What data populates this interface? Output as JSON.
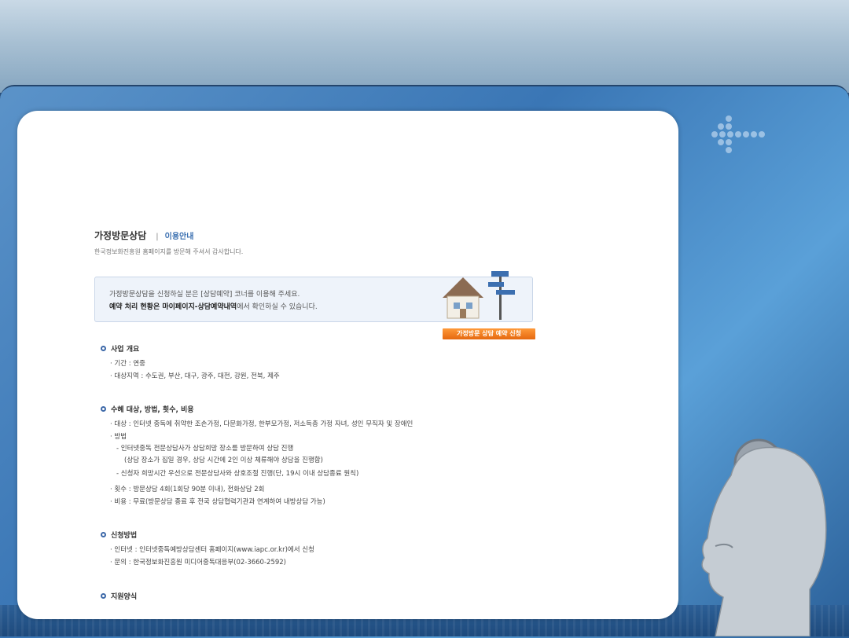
{
  "header": {
    "title": "가정방문상담",
    "separator": "|",
    "subtitle": "이용안내",
    "welcome": "한국정보화진흥원 홈페이지를 방문해 주셔서 감사합니다."
  },
  "notice": {
    "line1": "가정방문상담을 신청하실 분은 [상담예약] 코너를 이용해 주세요.",
    "line2_bold": "예약 처리 현황은 마이페이지-상담예약내역",
    "line2_rest": "에서 확인하실 수 있습니다."
  },
  "reserve_button": "가정방문 상담 예약 신청",
  "sections": {
    "overview": {
      "heading": "사업 개요",
      "items": [
        "· 기간 : 연중",
        "· 대상지역 : 수도권, 부산, 대구, 광주, 대전, 강원, 전북, 제주"
      ]
    },
    "target": {
      "heading": "수혜 대상, 방법, 횟수, 비용",
      "target_item": "· 대상 : 인터넷 중독에 취약한 조손가정, 다문화가정, 한부모가정, 저소득층 가정 자녀, 성인 무직자 및 장애인",
      "method_label": "· 방법",
      "method_1": "- 인터넷중독 전문상담사가 상담희망 장소를 방문하여 상담 진행",
      "method_1_note": "(상담 장소가 집일 경우, 상담 시간에 2인 이상 체류해야 상담을 진행함)",
      "method_2": "- 신청자 희망시간 우선으로 전문상담사와 상호조절 진행(단, 19시 이내 상담종료 원칙)",
      "count_item": "· 횟수 : 방문상담 4회(1회당 90분 이내), 전화상담 2회",
      "cost_item": "· 비용 : 무료(방문상담 종료 후 전국 상담협력기관과 연계하여 내방상담 가능)"
    },
    "apply": {
      "heading": "신청방법",
      "items": [
        "· 인터넷 : 인터넷중독예방상담센터 홈페이지(www.iapc.or.kr)에서 신청",
        "· 문의 : 한국정보화진흥원 미디어중독대응부(02-3660-2592)"
      ]
    },
    "next": {
      "heading": "지원양식"
    }
  },
  "colors": {
    "accent": "#3a6fb0",
    "button": "#e5680f",
    "notice_bg": "#eef3fa"
  }
}
